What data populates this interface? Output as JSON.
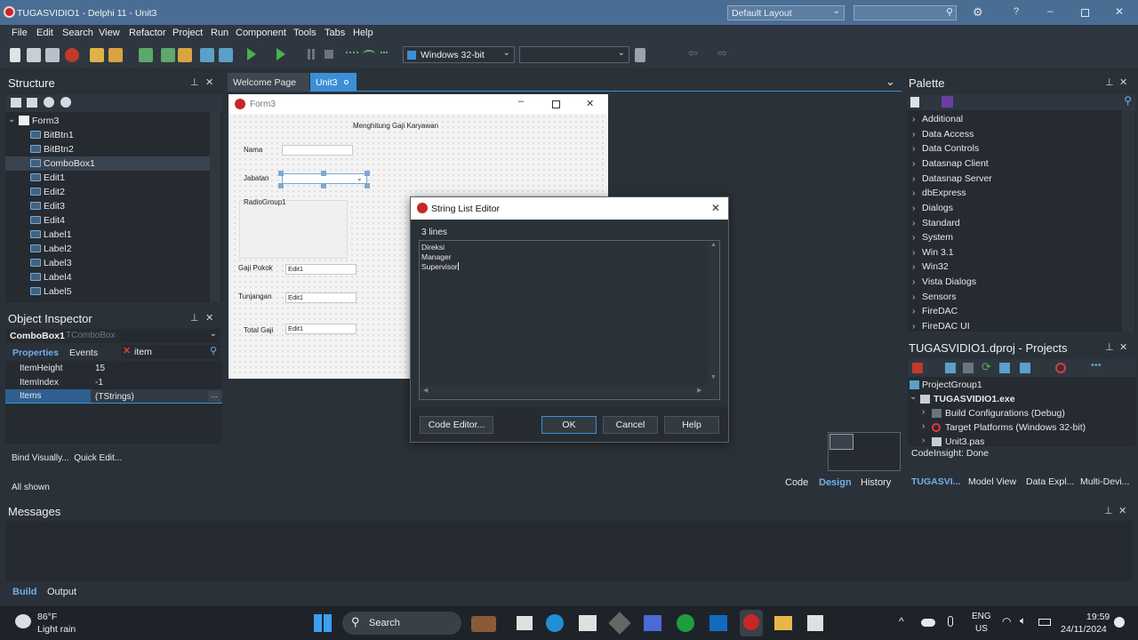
{
  "window": {
    "title": "TUGASVIDIO1 - Delphi 11 - Unit3",
    "layout": "Default Layout"
  },
  "menu": [
    "File",
    "Edit",
    "Search",
    "View",
    "Refactor",
    "Project",
    "Run",
    "Component",
    "Tools",
    "Tabs",
    "Help"
  ],
  "toolbar": {
    "platform": "Windows 32-bit",
    "config": ""
  },
  "structure": {
    "title": "Structure",
    "root": "Form3",
    "items": [
      "BitBtn1",
      "BitBtn2",
      "ComboBox1",
      "Edit1",
      "Edit2",
      "Edit3",
      "Edit4",
      "Label1",
      "Label2",
      "Label3",
      "Label4",
      "Label5"
    ]
  },
  "object_inspector": {
    "title": "Object Inspector",
    "component": "ComboBox1",
    "component_type": "TComboBox",
    "tabs": [
      "Properties",
      "Events"
    ],
    "search_text": "item",
    "props": [
      {
        "name": "ItemHeight",
        "value": "15"
      },
      {
        "name": "ItemIndex",
        "value": "-1"
      },
      {
        "name": "Items",
        "value": "(TStrings)"
      }
    ],
    "links": "Bind Visually...  Quick Edit...",
    "status": "All shown"
  },
  "editor": {
    "tabs": [
      "Welcome Page",
      "Unit3"
    ],
    "bottom_tabs": [
      "Code",
      "Design",
      "History"
    ]
  },
  "form": {
    "caption": "Form3",
    "heading": "Menghitung Gaji Karyawan",
    "labels": {
      "nama": "Nama",
      "jabatan": "Jabatan",
      "radio": "RadioGroup1",
      "gaji": "Gaji Pokok",
      "tunjangan": "Tunjangan",
      "total": "Total Gaji"
    },
    "edits": [
      "Edit1",
      "Edit1",
      "Edit1"
    ]
  },
  "dialog": {
    "title": "String List Editor",
    "count": "3 lines",
    "lines": [
      "Direksi",
      "Manager",
      "Supervisor"
    ],
    "buttons": {
      "code_editor": "Code Editor...",
      "ok": "OK",
      "cancel": "Cancel",
      "help": "Help"
    }
  },
  "palette": {
    "title": "Palette",
    "items": [
      "Additional",
      "Data Access",
      "Data Controls",
      "Datasnap Client",
      "Datasnap Server",
      "dbExpress",
      "Dialogs",
      "Standard",
      "System",
      "Win 3.1",
      "Win32",
      "Vista Dialogs",
      "Sensors",
      "FireDAC",
      "FireDAC UI"
    ]
  },
  "projects": {
    "title": "TUGASVIDIO1.dproj - Projects",
    "group": "ProjectGroup1",
    "exe": "TUGASVIDIO1.exe",
    "children": [
      "Build Configurations (Debug)",
      "Target Platforms (Windows 32-bit)",
      "Unit3.pas"
    ],
    "status": "CodeInsight: Done",
    "tabs": [
      "TUGASVI...",
      "Model View",
      "Data Expl...",
      "Multi-Devi..."
    ]
  },
  "messages": {
    "title": "Messages",
    "tabs": [
      "Build",
      "Output"
    ]
  },
  "taskbar": {
    "temp": "86°F",
    "weather": "Light rain",
    "search": "Search",
    "lang1": "ENG",
    "lang2": "US",
    "time": "19:59",
    "date": "24/11/2024"
  },
  "colors": {
    "accent": "#3b8fd6",
    "titlebar": "#4a6d94",
    "bg": "#2b3138"
  }
}
